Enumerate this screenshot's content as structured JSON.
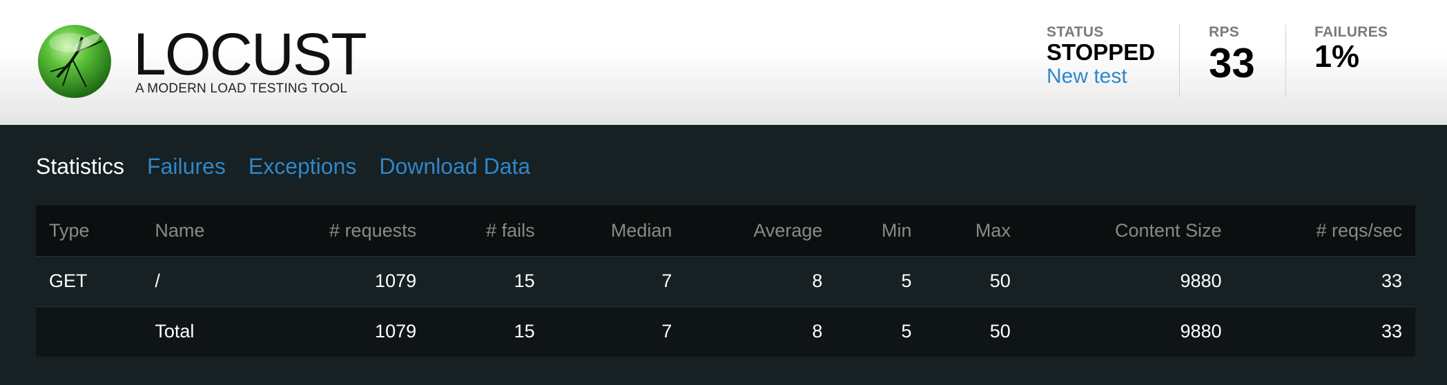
{
  "brand": {
    "name": "LOCUST",
    "tagline": "A MODERN LOAD TESTING TOOL"
  },
  "status": {
    "label": "STATUS",
    "value": "STOPPED",
    "new_test_label": "New test"
  },
  "rps": {
    "label": "RPS",
    "value": "33"
  },
  "failures": {
    "label": "FAILURES",
    "value": "1%"
  },
  "tabs": [
    {
      "label": "Statistics",
      "active": true
    },
    {
      "label": "Failures",
      "active": false
    },
    {
      "label": "Exceptions",
      "active": false
    },
    {
      "label": "Download Data",
      "active": false
    }
  ],
  "table": {
    "columns": [
      "Type",
      "Name",
      "# requests",
      "# fails",
      "Median",
      "Average",
      "Min",
      "Max",
      "Content Size",
      "# reqs/sec"
    ],
    "rows": [
      {
        "type": "GET",
        "name": "/",
        "requests": "1079",
        "fails": "15",
        "median": "7",
        "average": "8",
        "min": "5",
        "max": "50",
        "content_size": "9880",
        "reqs_sec": "33"
      },
      {
        "type": "",
        "name": "Total",
        "requests": "1079",
        "fails": "15",
        "median": "7",
        "average": "8",
        "min": "5",
        "max": "50",
        "content_size": "9880",
        "reqs_sec": "33"
      }
    ]
  },
  "colors": {
    "accent_link": "#2f87c9",
    "main_bg": "#172022",
    "header_row_bg": "#0b0f10",
    "logo_green": "#4caf2e"
  }
}
